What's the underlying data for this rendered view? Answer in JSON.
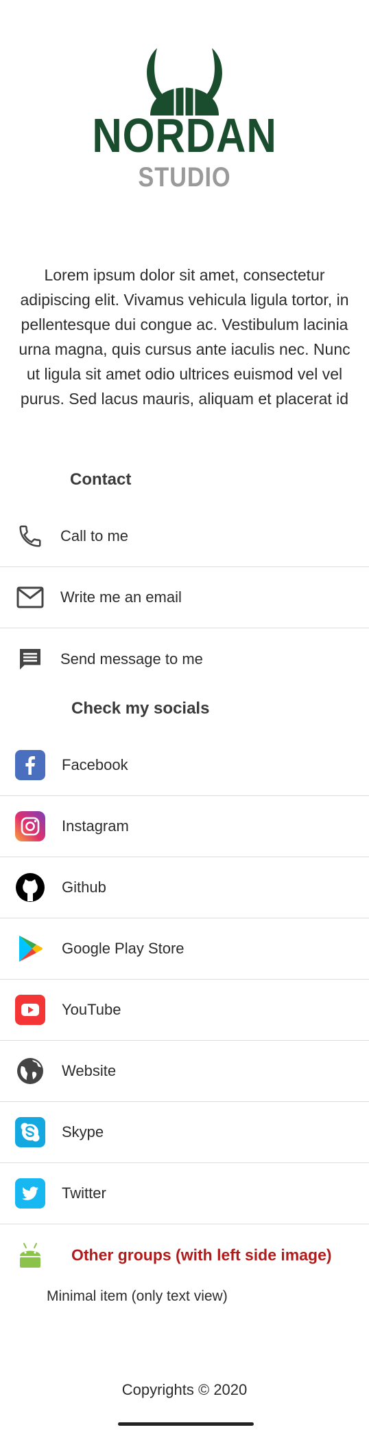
{
  "brand": {
    "title": "NORDAN",
    "subtitle": "STUDIO",
    "logo_icon": "viking-helmet-icon",
    "colors": {
      "primary": "#1a4d2e",
      "secondary": "#9a9a9a"
    }
  },
  "description": "Lorem ipsum dolor sit amet, consectetur adipiscing elit. Vivamus vehicula ligula tortor, in pellentesque dui congue ac. Vestibulum lacinia urna magna, quis cursus ante iaculis nec. Nunc ut ligula sit amet odio ultrices euismod vel vel purus. Sed lacus mauris, aliquam et placerat id",
  "contact": {
    "title": "Contact",
    "items": [
      {
        "label": "Call to me",
        "icon": "phone-icon"
      },
      {
        "label": "Write me an email",
        "icon": "email-icon"
      },
      {
        "label": "Send message to me",
        "icon": "message-icon"
      }
    ]
  },
  "socials": {
    "title": "Check my socials",
    "items": [
      {
        "label": "Facebook",
        "icon": "facebook-icon",
        "color": "#3b5998"
      },
      {
        "label": "Instagram",
        "icon": "instagram-icon",
        "color": "#c13584"
      },
      {
        "label": "Github",
        "icon": "github-icon",
        "color": "#000000"
      },
      {
        "label": "Google Play Store",
        "icon": "google-play-icon",
        "color": "#34a853"
      },
      {
        "label": "YouTube",
        "icon": "youtube-icon",
        "color": "#ff3333"
      },
      {
        "label": "Website",
        "icon": "globe-icon",
        "color": "#333333"
      },
      {
        "label": "Skype",
        "icon": "skype-icon",
        "color": "#00aff0"
      },
      {
        "label": "Twitter",
        "icon": "twitter-icon",
        "color": "#1da1f2"
      }
    ]
  },
  "other": {
    "label": "Other groups (with left side image)",
    "icon": "android-icon",
    "color": "#b01c1c"
  },
  "minimal_item": "Minimal item (only text view)",
  "footer": {
    "copyright": "Copyrights © 2020"
  }
}
